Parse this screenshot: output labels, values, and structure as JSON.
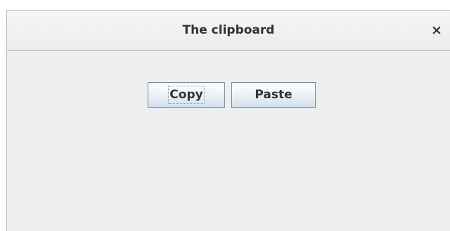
{
  "window": {
    "title": "The clipboard",
    "close_label": "×"
  },
  "buttons": {
    "copy_label": "Copy",
    "paste_label": "Paste"
  },
  "colors": {
    "titlebar": "#f1f1f1",
    "content_background": "#eeeeee",
    "button_border": "#7a8a99",
    "text": "#2e3436"
  },
  "icons": {
    "close": "close-icon"
  }
}
